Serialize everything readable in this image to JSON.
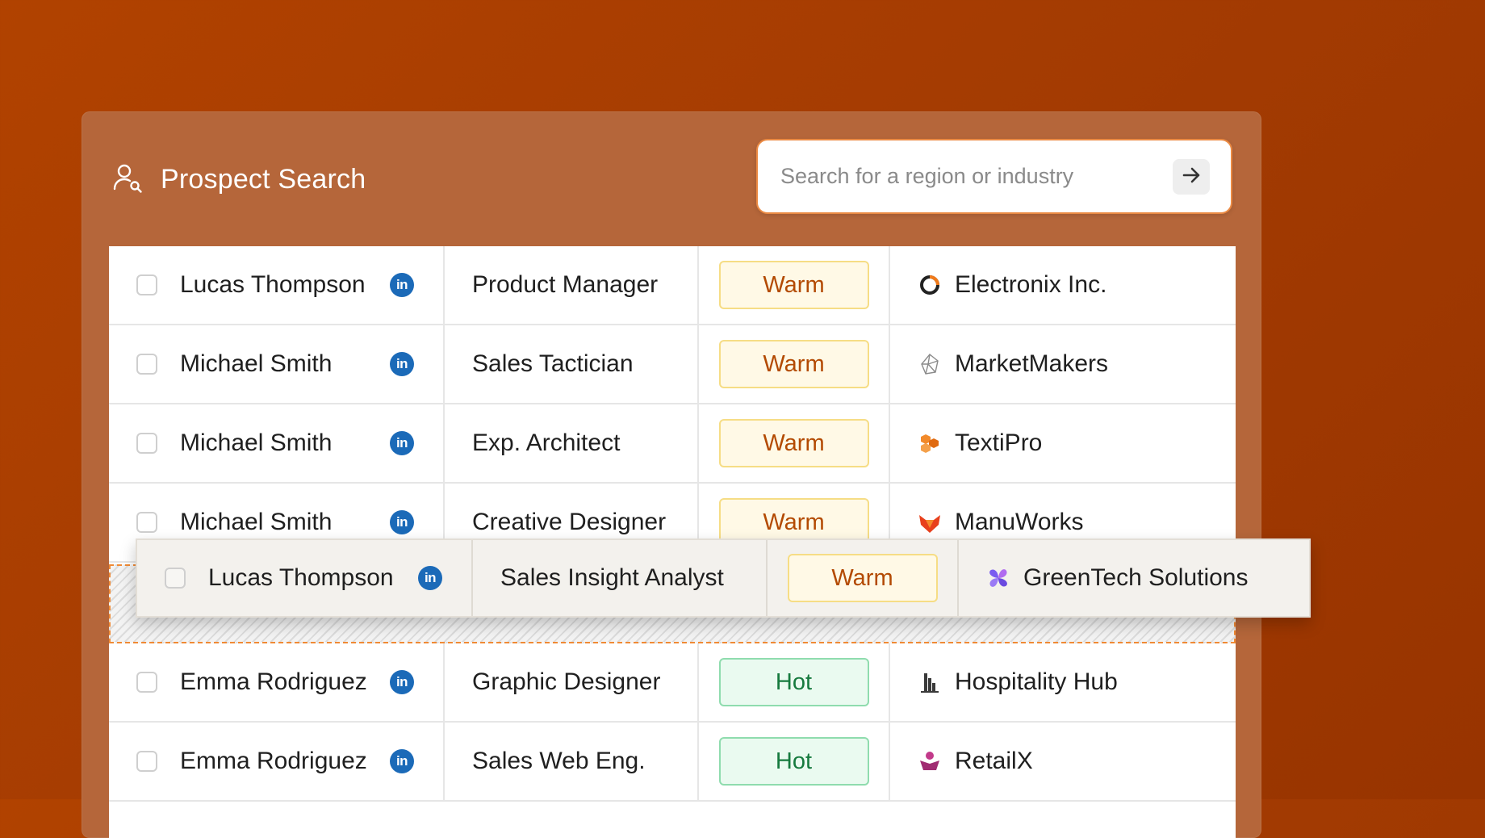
{
  "header": {
    "title": "Prospect Search",
    "icon": "user-search-icon"
  },
  "search": {
    "placeholder": "Search for a region or industry",
    "value": "",
    "submit_icon": "arrow-right-icon"
  },
  "rows": [
    {
      "name": "Lucas Thompson",
      "linkedin": "in",
      "role": "Product Manager",
      "status": "Warm",
      "company": "Electronix Inc.",
      "company_icon": "ring-logo-icon"
    },
    {
      "name": "Michael Smith",
      "linkedin": "in",
      "role": "Sales Tactician",
      "status": "Warm",
      "company": "MarketMakers",
      "company_icon": "polygon-logo-icon"
    },
    {
      "name": "Michael Smith",
      "linkedin": "in",
      "role": "Exp. Architect",
      "status": "Warm",
      "company": "TextiPro",
      "company_icon": "hexagons-logo-icon"
    },
    {
      "name": "Michael Smith",
      "linkedin": "in",
      "role": "Creative Designer",
      "status": "Warm",
      "company": "ManuWorks",
      "company_icon": "fox-logo-icon"
    },
    {
      "name": "Emma Rodriguez",
      "linkedin": "in",
      "role": "Graphic Designer",
      "status": "Hot",
      "company": "Hospitality Hub",
      "company_icon": "building-logo-icon"
    },
    {
      "name": "Emma Rodriguez",
      "linkedin": "in",
      "role": "Sales Web Eng.",
      "status": "Hot",
      "company": "RetailX",
      "company_icon": "person-logo-icon"
    }
  ],
  "dragging_row": {
    "name": "Lucas Thompson",
    "linkedin": "in",
    "role": "Sales Insight Analyst",
    "status": "Warm",
    "company": "GreenTech Solutions",
    "company_icon": "pinwheel-logo-icon"
  },
  "colors": {
    "background": "#a53c02",
    "panel": "#b5663a",
    "warm_text": "#b34a02",
    "warm_bg": "#fff9e6",
    "hot_text": "#167a3e",
    "hot_bg": "#eafaf0",
    "linkedin": "#1b6ab8",
    "drop_border": "#f08a35"
  }
}
